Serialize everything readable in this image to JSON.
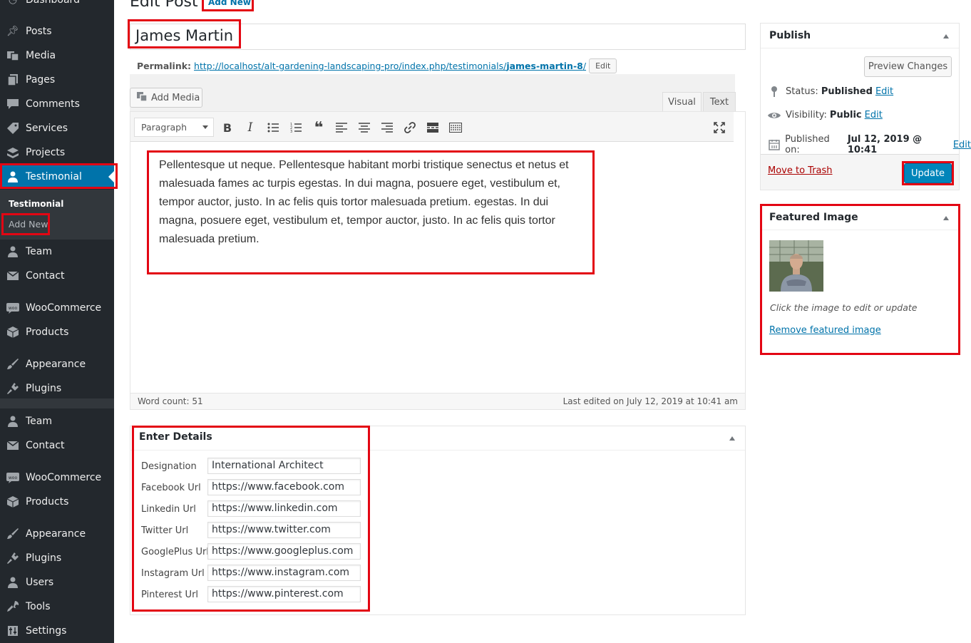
{
  "sidebar": {
    "items": [
      {
        "label": "Dashboard",
        "icon": "dashboard-icon"
      },
      {
        "label": "Posts",
        "icon": "pin-icon"
      },
      {
        "label": "Media",
        "icon": "media-icon"
      },
      {
        "label": "Pages",
        "icon": "pages-icon"
      },
      {
        "label": "Comments",
        "icon": "comment-icon"
      },
      {
        "label": "Services",
        "icon": "tag-icon"
      },
      {
        "label": "Projects",
        "icon": "portfolio-icon"
      },
      {
        "label": "Testimonial",
        "icon": "user-icon"
      },
      {
        "label": "Team",
        "icon": "user-icon"
      },
      {
        "label": "Contact",
        "icon": "mail-icon"
      },
      {
        "label": "WooCommerce",
        "icon": "woo-icon"
      },
      {
        "label": "Products",
        "icon": "box-icon"
      },
      {
        "label": "Appearance",
        "icon": "brush-icon"
      },
      {
        "label": "Plugins",
        "icon": "plugin-icon"
      },
      {
        "label": "Team",
        "icon": "user-icon"
      },
      {
        "label": "Contact",
        "icon": "mail-icon"
      },
      {
        "label": "WooCommerce",
        "icon": "woo-icon"
      },
      {
        "label": "Products",
        "icon": "box-icon"
      },
      {
        "label": "Appearance",
        "icon": "brush-icon"
      },
      {
        "label": "Plugins",
        "icon": "plugin-icon"
      },
      {
        "label": "Users",
        "icon": "user-icon"
      },
      {
        "label": "Tools",
        "icon": "wrench-icon"
      },
      {
        "label": "Settings",
        "icon": "settings-icon"
      }
    ],
    "submenu": {
      "title": "Testimonial",
      "add_new": "Add New"
    }
  },
  "header": {
    "title": "Edit Post",
    "add_new": "Add New"
  },
  "post": {
    "title": "James Martin",
    "permalink_label": "Permalink:",
    "permalink_base": "http://localhost/alt-gardening-landscaping-pro/index.php/testimonials/",
    "permalink_slug": "james-martin-8",
    "permalink_trail": "/",
    "permalink_edit": "Edit"
  },
  "editor": {
    "add_media": "Add Media",
    "tab_visual": "Visual",
    "tab_text": "Text",
    "format": "Paragraph",
    "content": "Pellentesque ut neque. Pellentesque habitant morbi tristique senectus et netus et malesuada fames ac turpis egestas. In dui magna, posuere eget, vestibulum et, tempor auctor, justo. In ac felis quis tortor malesuada pretium. egestas. In dui magna, posuere eget, vestibulum et, tempor auctor, justo. In ac felis quis tortor malesuada pretium.",
    "word_count": "Word count: 51",
    "last_edited": "Last edited on July 12, 2019 at 10:41 am"
  },
  "details": {
    "title": "Enter Details",
    "fields": [
      {
        "label": "Designation",
        "value": "International Architect"
      },
      {
        "label": "Facebook Url",
        "value": "https://www.facebook.com"
      },
      {
        "label": "Linkedin Url",
        "value": "https://www.linkedin.com"
      },
      {
        "label": "Twitter Url",
        "value": "https://www.twitter.com"
      },
      {
        "label": "GooglePlus Url",
        "value": "https://www.googleplus.com"
      },
      {
        "label": "Instagram Url",
        "value": "https://www.instagram.com"
      },
      {
        "label": "Pinterest Url",
        "value": "https://www.pinterest.com"
      }
    ]
  },
  "publish": {
    "title": "Publish",
    "preview": "Preview Changes",
    "status_label": "Status:",
    "status_value": "Published",
    "visibility_label": "Visibility:",
    "visibility_value": "Public",
    "published_label": "Published on:",
    "published_value": "Jul 12, 2019 @ 10:41",
    "edit": "Edit",
    "trash": "Move to Trash",
    "update": "Update"
  },
  "featured": {
    "title": "Featured Image",
    "hint": "Click the image to edit or update",
    "remove": "Remove featured image"
  },
  "colors": {
    "accent": "#0073aa",
    "highlight": "#e30613",
    "sidebar": "#23282d"
  }
}
